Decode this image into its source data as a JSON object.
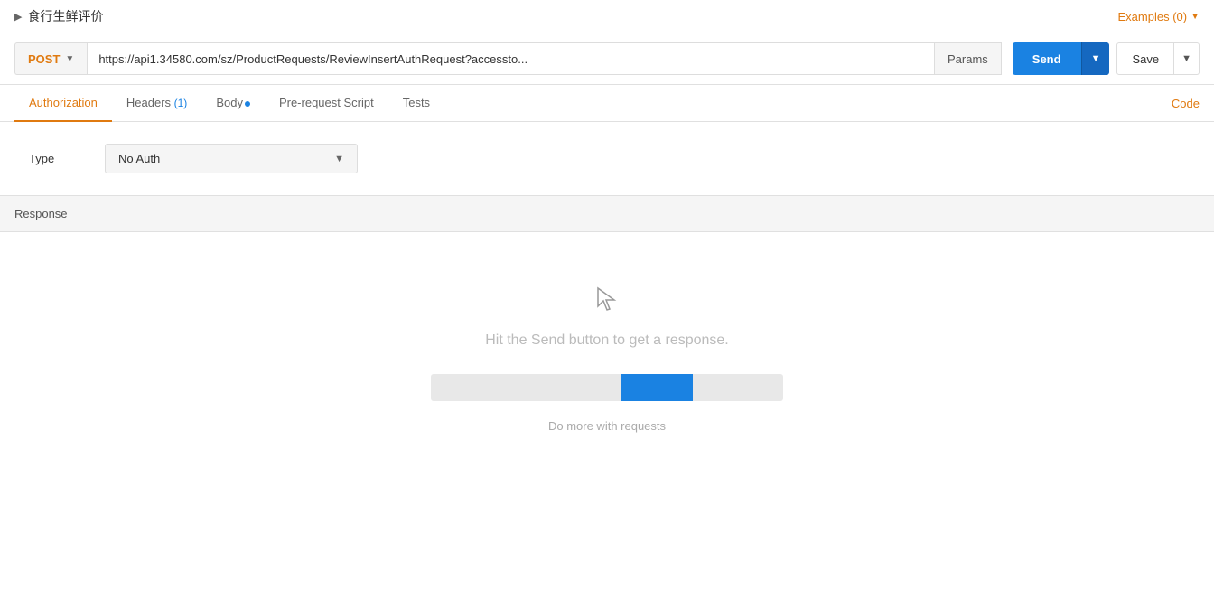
{
  "topbar": {
    "collection_title": "食行生鲜评价",
    "examples_label": "Examples (0)"
  },
  "request": {
    "method": "POST",
    "url": "https://api1.34580.com/sz/ProductRequests/ReviewInsertAuthRequest?accessto...",
    "params_label": "Params",
    "send_label": "Send",
    "save_label": "Save"
  },
  "tabs": [
    {
      "id": "authorization",
      "label": "Authorization",
      "active": true
    },
    {
      "id": "headers",
      "label": "Headers",
      "badge": "(1)",
      "active": false
    },
    {
      "id": "body",
      "label": "Body",
      "dot": true,
      "active": false
    },
    {
      "id": "pre-request",
      "label": "Pre-request Script",
      "active": false
    },
    {
      "id": "tests",
      "label": "Tests",
      "active": false
    }
  ],
  "code_link": "Code",
  "auth": {
    "type_label": "Type",
    "type_value": "No Auth"
  },
  "response": {
    "section_label": "Response",
    "hint": "Hit the Send button to get a response.",
    "do_more_label": "Do more with requests"
  }
}
